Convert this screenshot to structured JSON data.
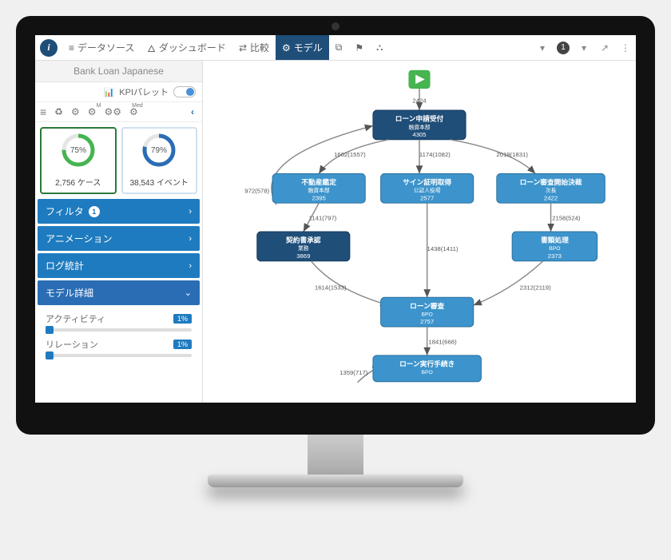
{
  "nav": {
    "datasource": "データソース",
    "dashboard": "ダッシュボード",
    "compare": "比較",
    "model": "モデル",
    "filter_badge": "1"
  },
  "sidebar": {
    "project_name": "Bank Loan Japanese",
    "kpi_label": "KPIパレット",
    "donuts": [
      {
        "pct": "75%",
        "value_label": "2,756 ケース"
      },
      {
        "pct": "79%",
        "value_label": "38,543 イベント"
      }
    ],
    "accordion": {
      "filter": {
        "label": "フィルタ",
        "badge": "1"
      },
      "animation": {
        "label": "アニメーション"
      },
      "logstats": {
        "label": "ログ統計"
      },
      "detail": {
        "label": "モデル詳細"
      }
    },
    "sliders": {
      "activity": {
        "label": "アクティビティ",
        "pct": "1%"
      },
      "relation": {
        "label": "リレーション",
        "pct": "1%"
      }
    }
  },
  "diagram": {
    "start_count": "2424",
    "nodes": {
      "n1": {
        "title": "ローン申請受付",
        "sub": "融資本部",
        "count": "4305"
      },
      "n2": {
        "title": "不動産鑑定",
        "sub": "融資本部",
        "count": "2395"
      },
      "n3": {
        "title": "サイン証明取得",
        "sub": "公証人役場",
        "count": "2577"
      },
      "n4": {
        "title": "ローン審査開始決裁",
        "sub": "次長",
        "count": "2422"
      },
      "n5": {
        "title": "契約書承認",
        "sub": "業務",
        "count": "3869"
      },
      "n6": {
        "title": "書類処理",
        "sub": "BPO",
        "count": "2373"
      },
      "n7": {
        "title": "ローン審査",
        "sub": "BPO",
        "count": "2757"
      },
      "n8": {
        "title": "ローン実行手続き",
        "sub": "BPO",
        "count": ""
      }
    },
    "edges": {
      "e_start_n1": "2424",
      "e_n1_n2": "1602(1557)",
      "e_n1_n3": "1174(1082)",
      "e_n1_n4": "2019(1831)",
      "e_n2_n5": "1141(797)",
      "e_n4_n6": "2158(524)",
      "e_n3_n7": "1438(1411)",
      "e_n5_n7": "1614(1533)",
      "e_n6_n7": "2312(2119)",
      "e_n7_n8": "1841(668)",
      "e_loop_left": "972(578)",
      "e_n8_side": "1359(717)"
    }
  }
}
